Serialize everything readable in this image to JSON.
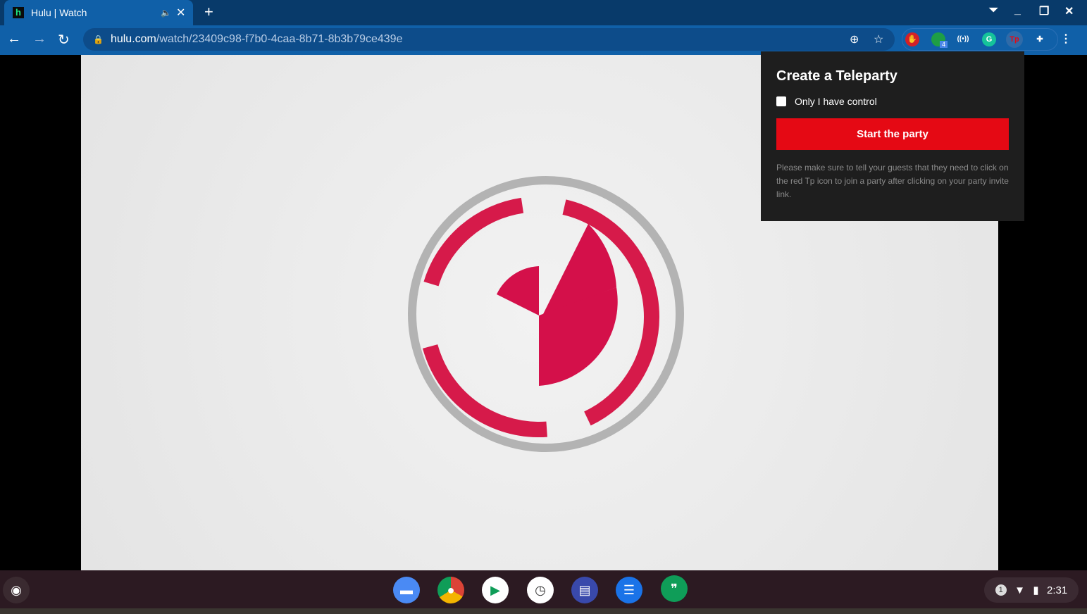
{
  "tab": {
    "title": "Hulu | Watch",
    "favicon": "h"
  },
  "url": {
    "domain": "hulu.com",
    "path": "/watch/23409c98-f7b0-4caa-8b71-8b3b79ce439e"
  },
  "extensions": {
    "badge": "4",
    "teleparty": "Tp"
  },
  "popup": {
    "title": "Create a Teleparty",
    "checkbox_label": "Only I have control",
    "checked": false,
    "button": "Start the party",
    "note": "Please make sure to tell your guests that they need to click on the red Tp icon to join a party after clicking on your party invite link.",
    "accent": "#e50914"
  },
  "tray": {
    "notifications": "1",
    "time": "2:31"
  }
}
